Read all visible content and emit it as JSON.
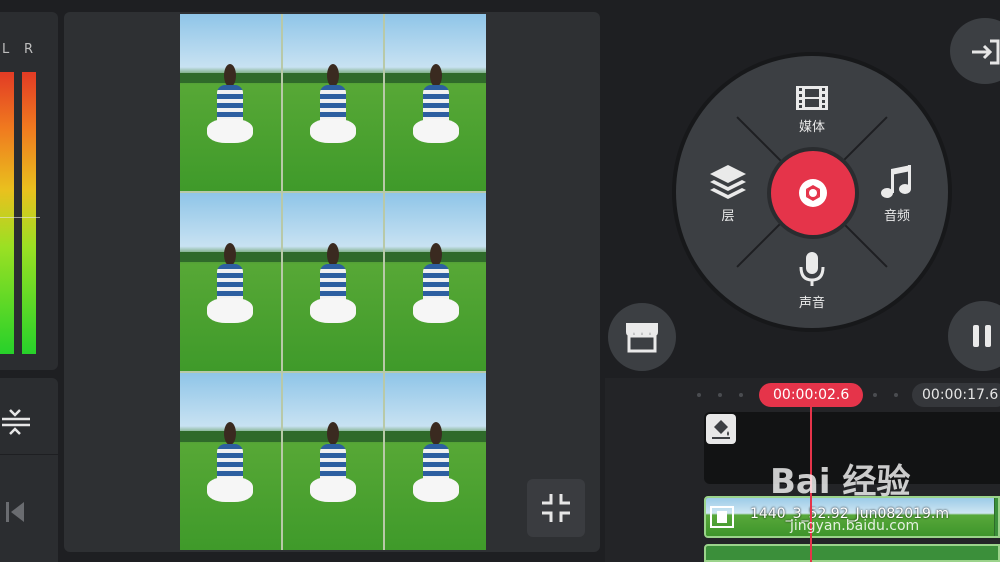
{
  "meter": {
    "left_label": "L",
    "right_label": "R"
  },
  "media_wheel": {
    "items": [
      {
        "label": "媒体",
        "icon": "film-icon"
      },
      {
        "label": "层",
        "icon": "layers-icon"
      },
      {
        "label": "音频",
        "icon": "music-note-icon"
      },
      {
        "label": "声音",
        "icon": "microphone-icon"
      }
    ],
    "center_icon": "camera-shutter-icon"
  },
  "timeline": {
    "playhead_time": "00:00:02.6",
    "total_time": "00:00:17.6",
    "clip_name": "1440_3_52.92_Jun082019.m"
  },
  "watermark": {
    "text": "Bai 经验",
    "url": "jingyan.baidu.com"
  },
  "colors": {
    "accent": "#e5344a",
    "panel": "#2b2d30",
    "wheel": "#3c3f43"
  }
}
